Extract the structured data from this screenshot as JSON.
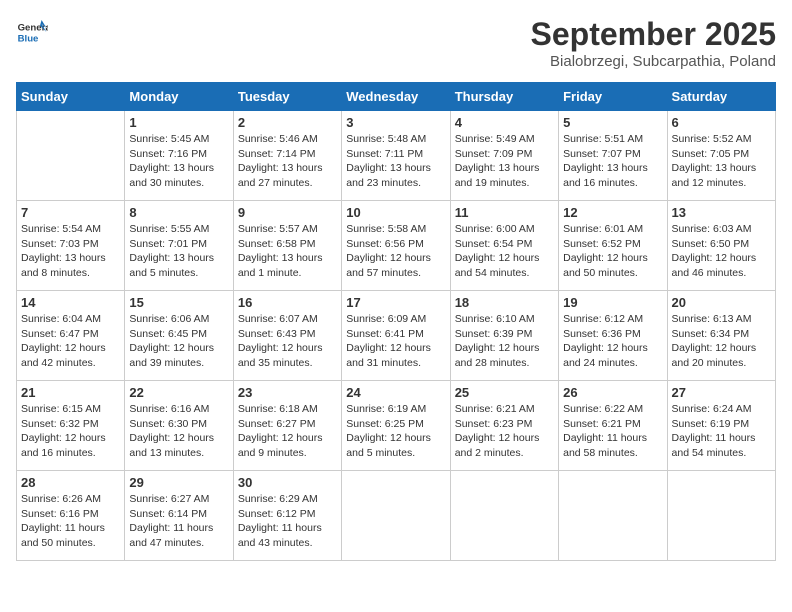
{
  "header": {
    "logo_text_general": "General",
    "logo_text_blue": "Blue",
    "month_title": "September 2025",
    "location": "Bialobrzegi, Subcarpathia, Poland"
  },
  "weekdays": [
    "Sunday",
    "Monday",
    "Tuesday",
    "Wednesday",
    "Thursday",
    "Friday",
    "Saturday"
  ],
  "weeks": [
    [
      {
        "day": "",
        "info": ""
      },
      {
        "day": "1",
        "info": "Sunrise: 5:45 AM\nSunset: 7:16 PM\nDaylight: 13 hours\nand 30 minutes."
      },
      {
        "day": "2",
        "info": "Sunrise: 5:46 AM\nSunset: 7:14 PM\nDaylight: 13 hours\nand 27 minutes."
      },
      {
        "day": "3",
        "info": "Sunrise: 5:48 AM\nSunset: 7:11 PM\nDaylight: 13 hours\nand 23 minutes."
      },
      {
        "day": "4",
        "info": "Sunrise: 5:49 AM\nSunset: 7:09 PM\nDaylight: 13 hours\nand 19 minutes."
      },
      {
        "day": "5",
        "info": "Sunrise: 5:51 AM\nSunset: 7:07 PM\nDaylight: 13 hours\nand 16 minutes."
      },
      {
        "day": "6",
        "info": "Sunrise: 5:52 AM\nSunset: 7:05 PM\nDaylight: 13 hours\nand 12 minutes."
      }
    ],
    [
      {
        "day": "7",
        "info": "Sunrise: 5:54 AM\nSunset: 7:03 PM\nDaylight: 13 hours\nand 8 minutes."
      },
      {
        "day": "8",
        "info": "Sunrise: 5:55 AM\nSunset: 7:01 PM\nDaylight: 13 hours\nand 5 minutes."
      },
      {
        "day": "9",
        "info": "Sunrise: 5:57 AM\nSunset: 6:58 PM\nDaylight: 13 hours\nand 1 minute."
      },
      {
        "day": "10",
        "info": "Sunrise: 5:58 AM\nSunset: 6:56 PM\nDaylight: 12 hours\nand 57 minutes."
      },
      {
        "day": "11",
        "info": "Sunrise: 6:00 AM\nSunset: 6:54 PM\nDaylight: 12 hours\nand 54 minutes."
      },
      {
        "day": "12",
        "info": "Sunrise: 6:01 AM\nSunset: 6:52 PM\nDaylight: 12 hours\nand 50 minutes."
      },
      {
        "day": "13",
        "info": "Sunrise: 6:03 AM\nSunset: 6:50 PM\nDaylight: 12 hours\nand 46 minutes."
      }
    ],
    [
      {
        "day": "14",
        "info": "Sunrise: 6:04 AM\nSunset: 6:47 PM\nDaylight: 12 hours\nand 42 minutes."
      },
      {
        "day": "15",
        "info": "Sunrise: 6:06 AM\nSunset: 6:45 PM\nDaylight: 12 hours\nand 39 minutes."
      },
      {
        "day": "16",
        "info": "Sunrise: 6:07 AM\nSunset: 6:43 PM\nDaylight: 12 hours\nand 35 minutes."
      },
      {
        "day": "17",
        "info": "Sunrise: 6:09 AM\nSunset: 6:41 PM\nDaylight: 12 hours\nand 31 minutes."
      },
      {
        "day": "18",
        "info": "Sunrise: 6:10 AM\nSunset: 6:39 PM\nDaylight: 12 hours\nand 28 minutes."
      },
      {
        "day": "19",
        "info": "Sunrise: 6:12 AM\nSunset: 6:36 PM\nDaylight: 12 hours\nand 24 minutes."
      },
      {
        "day": "20",
        "info": "Sunrise: 6:13 AM\nSunset: 6:34 PM\nDaylight: 12 hours\nand 20 minutes."
      }
    ],
    [
      {
        "day": "21",
        "info": "Sunrise: 6:15 AM\nSunset: 6:32 PM\nDaylight: 12 hours\nand 16 minutes."
      },
      {
        "day": "22",
        "info": "Sunrise: 6:16 AM\nSunset: 6:30 PM\nDaylight: 12 hours\nand 13 minutes."
      },
      {
        "day": "23",
        "info": "Sunrise: 6:18 AM\nSunset: 6:27 PM\nDaylight: 12 hours\nand 9 minutes."
      },
      {
        "day": "24",
        "info": "Sunrise: 6:19 AM\nSunset: 6:25 PM\nDaylight: 12 hours\nand 5 minutes."
      },
      {
        "day": "25",
        "info": "Sunrise: 6:21 AM\nSunset: 6:23 PM\nDaylight: 12 hours\nand 2 minutes."
      },
      {
        "day": "26",
        "info": "Sunrise: 6:22 AM\nSunset: 6:21 PM\nDaylight: 11 hours\nand 58 minutes."
      },
      {
        "day": "27",
        "info": "Sunrise: 6:24 AM\nSunset: 6:19 PM\nDaylight: 11 hours\nand 54 minutes."
      }
    ],
    [
      {
        "day": "28",
        "info": "Sunrise: 6:26 AM\nSunset: 6:16 PM\nDaylight: 11 hours\nand 50 minutes."
      },
      {
        "day": "29",
        "info": "Sunrise: 6:27 AM\nSunset: 6:14 PM\nDaylight: 11 hours\nand 47 minutes."
      },
      {
        "day": "30",
        "info": "Sunrise: 6:29 AM\nSunset: 6:12 PM\nDaylight: 11 hours\nand 43 minutes."
      },
      {
        "day": "",
        "info": ""
      },
      {
        "day": "",
        "info": ""
      },
      {
        "day": "",
        "info": ""
      },
      {
        "day": "",
        "info": ""
      }
    ]
  ]
}
